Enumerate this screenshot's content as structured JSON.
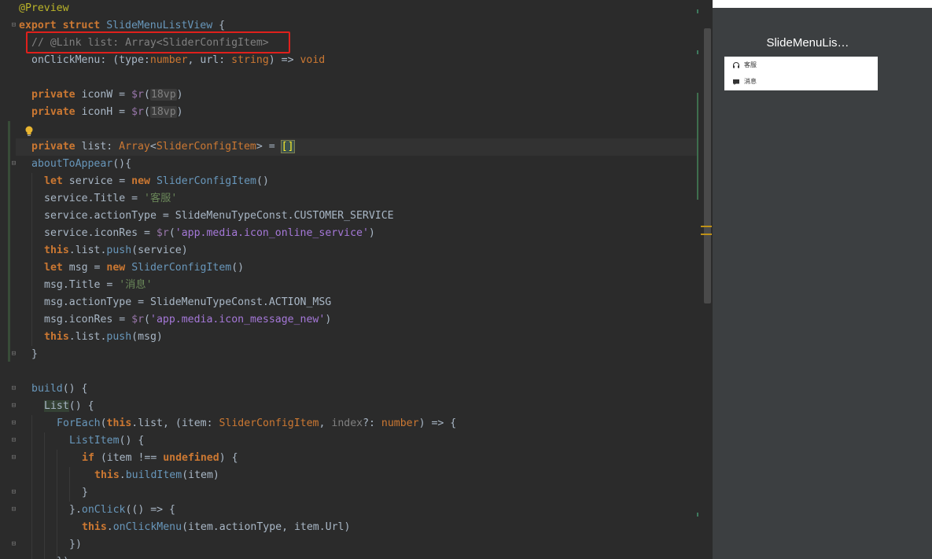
{
  "editor": {
    "lines": [
      {
        "id": "l1",
        "tokens": [
          [
            "anno",
            "@Preview"
          ]
        ]
      },
      {
        "id": "l2",
        "tokens": [
          [
            "kw",
            "export"
          ],
          [
            "",
            " "
          ],
          [
            "kw",
            "struct"
          ],
          [
            "",
            " "
          ],
          [
            "struct-name",
            "SlideMenuListView"
          ],
          [
            "",
            " {"
          ]
        ]
      },
      {
        "id": "l3",
        "tokens": [
          [
            "cmt",
            "// @Link list: Array<SliderConfigItem>"
          ]
        ]
      },
      {
        "id": "l4",
        "tokens": [
          [
            "",
            "onClickMenu: ("
          ],
          [
            "",
            "type"
          ],
          [
            "",
            ":"
          ],
          [
            "typ",
            "number"
          ],
          [
            "",
            ", "
          ],
          [
            "",
            "url"
          ],
          [
            "",
            ": "
          ],
          [
            "typ",
            "string"
          ],
          [
            "",
            ") => "
          ],
          [
            "typ",
            "void"
          ]
        ]
      },
      {
        "id": "l5",
        "tokens": []
      },
      {
        "id": "l6",
        "tokens": [
          [
            "kw",
            "private"
          ],
          [
            "",
            " iconW = "
          ],
          [
            "dollar",
            "$r"
          ],
          [
            "",
            "("
          ],
          [
            "hint",
            "18vp"
          ],
          [
            "",
            ")"
          ]
        ]
      },
      {
        "id": "l7",
        "tokens": [
          [
            "kw",
            "private"
          ],
          [
            "",
            " iconH = "
          ],
          [
            "dollar",
            "$r"
          ],
          [
            "",
            "("
          ],
          [
            "hint",
            "18vp"
          ],
          [
            "",
            ")"
          ]
        ]
      },
      {
        "id": "l8",
        "tokens": []
      },
      {
        "id": "l9",
        "tokens": [
          [
            "kw",
            "private"
          ],
          [
            "",
            " list: "
          ],
          [
            "typ",
            "Array"
          ],
          [
            "",
            "<"
          ],
          [
            "typ",
            "SliderConfigItem"
          ],
          [
            "",
            "> = "
          ],
          [
            "bracket-hl",
            "[]"
          ]
        ]
      },
      {
        "id": "l10",
        "tokens": [
          [
            "cls",
            "aboutToAppear"
          ],
          [
            "",
            "(){"
          ]
        ]
      },
      {
        "id": "l11",
        "tokens": [
          [
            "kw",
            "let"
          ],
          [
            "",
            " service = "
          ],
          [
            "kw",
            "new"
          ],
          [
            "",
            " "
          ],
          [
            "cls",
            "SliderConfigItem"
          ],
          [
            "",
            "()"
          ]
        ]
      },
      {
        "id": "l12",
        "tokens": [
          [
            "",
            "service.Title = "
          ],
          [
            "str",
            "'客服'"
          ]
        ]
      },
      {
        "id": "l13",
        "tokens": [
          [
            "",
            "service.actionType = SlideMenuTypeConst.CUSTOMER_SERVICE"
          ]
        ]
      },
      {
        "id": "l14",
        "tokens": [
          [
            "",
            "service.iconRes = "
          ],
          [
            "dollar",
            "$r"
          ],
          [
            "",
            "("
          ],
          [
            "media",
            "'app.media.icon_online_service'"
          ],
          [
            "",
            ")"
          ]
        ]
      },
      {
        "id": "l15",
        "tokens": [
          [
            "this",
            "this"
          ],
          [
            "",
            ".list."
          ],
          [
            "cls",
            "push"
          ],
          [
            "",
            "(service)"
          ]
        ]
      },
      {
        "id": "l16",
        "tokens": [
          [
            "kw",
            "let"
          ],
          [
            "",
            " msg = "
          ],
          [
            "kw",
            "new"
          ],
          [
            "",
            " "
          ],
          [
            "cls",
            "SliderConfigItem"
          ],
          [
            "",
            "()"
          ]
        ]
      },
      {
        "id": "l17",
        "tokens": [
          [
            "",
            "msg.Title = "
          ],
          [
            "str",
            "'消息'"
          ]
        ]
      },
      {
        "id": "l18",
        "tokens": [
          [
            "",
            "msg.actionType = SlideMenuTypeConst.ACTION_MSG"
          ]
        ]
      },
      {
        "id": "l19",
        "tokens": [
          [
            "",
            "msg.iconRes = "
          ],
          [
            "dollar",
            "$r"
          ],
          [
            "",
            "("
          ],
          [
            "media",
            "'app.media.icon_message_new'"
          ],
          [
            "",
            ")"
          ]
        ]
      },
      {
        "id": "l20",
        "tokens": [
          [
            "this",
            "this"
          ],
          [
            "",
            ".list."
          ],
          [
            "cls",
            "push"
          ],
          [
            "",
            "(msg)"
          ]
        ]
      },
      {
        "id": "l21",
        "tokens": [
          [
            "",
            "}"
          ]
        ]
      },
      {
        "id": "l22",
        "tokens": []
      },
      {
        "id": "l23",
        "tokens": [
          [
            "cls",
            "build"
          ],
          [
            "",
            "() {"
          ]
        ]
      },
      {
        "id": "l24",
        "tokens": [
          [
            "list-hl",
            "List"
          ],
          [
            "",
            "() {"
          ]
        ]
      },
      {
        "id": "l25",
        "tokens": [
          [
            "cls",
            "ForEach"
          ],
          [
            "",
            "("
          ],
          [
            "this",
            "this"
          ],
          [
            "",
            ".list, (item: "
          ],
          [
            "typ",
            "SliderConfigItem"
          ],
          [
            "",
            ", "
          ],
          [
            "dim",
            "index"
          ],
          [
            "",
            "?: "
          ],
          [
            "typ",
            "number"
          ],
          [
            "",
            ") => {"
          ]
        ]
      },
      {
        "id": "l26",
        "tokens": [
          [
            "cls",
            "ListItem"
          ],
          [
            "",
            "() {"
          ]
        ]
      },
      {
        "id": "l27",
        "tokens": [
          [
            "kw",
            "if"
          ],
          [
            "",
            " (item !== "
          ],
          [
            "kw",
            "undefined"
          ],
          [
            "",
            ") {"
          ]
        ]
      },
      {
        "id": "l28",
        "tokens": [
          [
            "this",
            "this"
          ],
          [
            "",
            "."
          ],
          [
            "cls",
            "buildItem"
          ],
          [
            "",
            "(item)"
          ]
        ]
      },
      {
        "id": "l29",
        "tokens": [
          [
            "",
            "}"
          ]
        ]
      },
      {
        "id": "l30",
        "tokens": [
          [
            "",
            "}."
          ],
          [
            "cls",
            "onClick"
          ],
          [
            "",
            "(() => {"
          ]
        ]
      },
      {
        "id": "l31",
        "tokens": [
          [
            "this",
            "this"
          ],
          [
            "",
            "."
          ],
          [
            "cls",
            "onClickMenu"
          ],
          [
            "",
            "(item.actionType, item.Url)"
          ]
        ]
      },
      {
        "id": "l32",
        "tokens": [
          [
            "",
            "})"
          ]
        ]
      },
      {
        "id": "l33",
        "tokens": [
          [
            "",
            "})"
          ]
        ]
      }
    ]
  },
  "preview": {
    "title": "SlideMenuLis…",
    "menu_items": [
      {
        "label": "客服",
        "icon": "headset-icon"
      },
      {
        "label": "消息",
        "icon": "message-icon"
      }
    ]
  },
  "colors": {
    "editor_bg": "#2b2b2b",
    "highlight_box": "#e0201c",
    "preview_bg": "#3c3f41"
  }
}
